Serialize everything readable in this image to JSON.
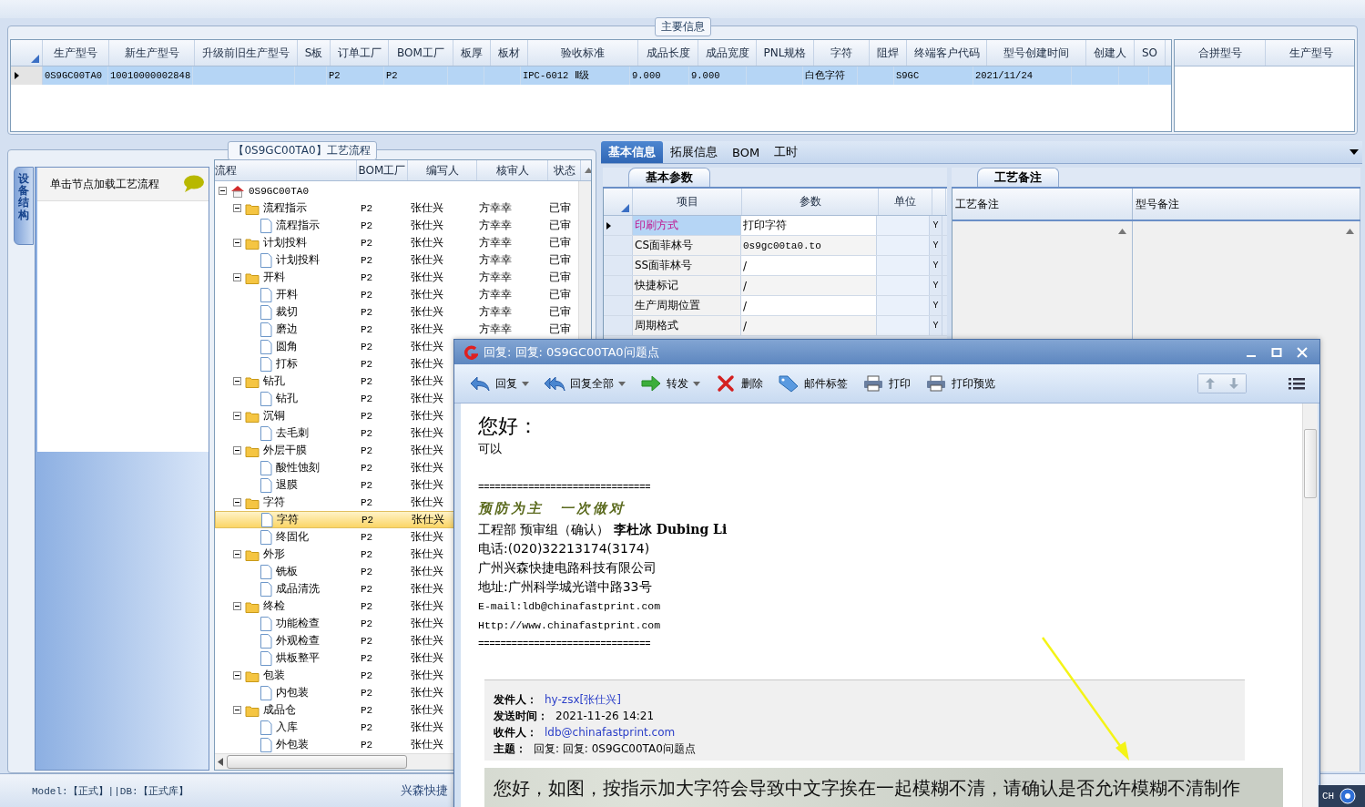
{
  "main_info": {
    "title": "主要信息",
    "columns": [
      "生产型号",
      "新生产型号",
      "升级前旧生产型号",
      "S板",
      "订单工厂",
      "BOM工厂",
      "板厚",
      "板材",
      "验收标准",
      "成品长度",
      "成品宽度",
      "PNL规格",
      "字符",
      "阻焊",
      "终端客户代码",
      "型号创建时间",
      "创建人",
      "SO"
    ],
    "rows": [
      {
        "selected": true,
        "cells": [
          "0S9GC00TA0",
          "10010000002848",
          null,
          null,
          "P2",
          "P2",
          null,
          null,
          "IPC-6012 Ⅱ级",
          "9.000",
          "9.000",
          null,
          "白色字符",
          null,
          "S9GC",
          "2021/11/24",
          null,
          null
        ]
      }
    ],
    "merge_columns": [
      "合拼型号",
      "生产型号"
    ]
  },
  "process_panel": {
    "title": "【0S9GC00TA0】工艺流程",
    "side_tab": "设备结构",
    "hint": "单击节点加载工艺流程",
    "columns": [
      "流程",
      "BOM工厂",
      "编写人",
      "核审人",
      "状态"
    ],
    "tree": [
      {
        "label": "0S9GC00TA0",
        "kind": "root",
        "expanded": true,
        "selected": false,
        "children": [
          {
            "label": "流程指示",
            "kind": "folder",
            "expanded": true,
            "selected": false,
            "bom": "P2",
            "writer": "张仕兴",
            "reviewer": "方幸幸",
            "status": "已审",
            "children": [
              {
                "label": "流程指示",
                "kind": "doc",
                "selected": false,
                "bom": "P2",
                "writer": "张仕兴",
                "reviewer": "方幸幸",
                "status": "已审"
              }
            ]
          },
          {
            "label": "计划投料",
            "kind": "folder",
            "expanded": true,
            "selected": false,
            "bom": "P2",
            "writer": "张仕兴",
            "reviewer": "方幸幸",
            "status": "已审",
            "children": [
              {
                "label": "计划投料",
                "kind": "doc",
                "selected": false,
                "bom": "P2",
                "writer": "张仕兴",
                "reviewer": "方幸幸",
                "status": "已审"
              }
            ]
          },
          {
            "label": "开料",
            "kind": "folder",
            "expanded": true,
            "selected": false,
            "bom": "P2",
            "writer": "张仕兴",
            "reviewer": "方幸幸",
            "status": "已审",
            "children": [
              {
                "label": "开料",
                "kind": "doc",
                "selected": false,
                "bom": "P2",
                "writer": "张仕兴",
                "reviewer": "方幸幸",
                "status": "已审"
              },
              {
                "label": "裁切",
                "kind": "doc",
                "selected": false,
                "bom": "P2",
                "writer": "张仕兴",
                "reviewer": "方幸幸",
                "status": "已审"
              },
              {
                "label": "磨边",
                "kind": "doc",
                "selected": false,
                "bom": "P2",
                "writer": "张仕兴",
                "reviewer": "方幸幸",
                "status": "已审"
              },
              {
                "label": "圆角",
                "kind": "doc",
                "selected": false,
                "bom": "P2",
                "writer": "张仕兴"
              },
              {
                "label": "打标",
                "kind": "doc",
                "selected": false,
                "bom": "P2",
                "writer": "张仕兴"
              }
            ]
          },
          {
            "label": "钻孔",
            "kind": "folder",
            "expanded": true,
            "selected": false,
            "bom": "P2",
            "writer": "张仕兴",
            "children": [
              {
                "label": "钻孔",
                "kind": "doc",
                "selected": false,
                "bom": "P2",
                "writer": "张仕兴"
              }
            ]
          },
          {
            "label": "沉铜",
            "kind": "folder",
            "expanded": true,
            "selected": false,
            "bom": "P2",
            "writer": "张仕兴",
            "children": [
              {
                "label": "去毛刺",
                "kind": "doc",
                "selected": false,
                "bom": "P2",
                "writer": "张仕兴"
              }
            ]
          },
          {
            "label": "外层干膜",
            "kind": "folder",
            "expanded": true,
            "selected": false,
            "bom": "P2",
            "writer": "张仕兴",
            "children": [
              {
                "label": "酸性蚀刻",
                "kind": "doc",
                "selected": false,
                "bom": "P2",
                "writer": "张仕兴"
              },
              {
                "label": "退膜",
                "kind": "doc",
                "selected": false,
                "bom": "P2",
                "writer": "张仕兴"
              }
            ]
          },
          {
            "label": "字符",
            "kind": "folder",
            "expanded": true,
            "selected": false,
            "bom": "P2",
            "writer": "张仕兴",
            "children": [
              {
                "label": "字符",
                "kind": "doc",
                "selected": true,
                "bom": "P2",
                "writer": "张仕兴"
              },
              {
                "label": "终固化",
                "kind": "doc",
                "selected": false,
                "bom": "P2",
                "writer": "张仕兴"
              }
            ]
          },
          {
            "label": "外形",
            "kind": "folder",
            "expanded": true,
            "selected": false,
            "bom": "P2",
            "writer": "张仕兴",
            "children": [
              {
                "label": "铣板",
                "kind": "doc",
                "selected": false,
                "bom": "P2",
                "writer": "张仕兴"
              },
              {
                "label": "成品清洗",
                "kind": "doc",
                "selected": false,
                "bom": "P2",
                "writer": "张仕兴"
              }
            ]
          },
          {
            "label": "终检",
            "kind": "folder",
            "expanded": true,
            "selected": false,
            "bom": "P2",
            "writer": "张仕兴",
            "children": [
              {
                "label": "功能检查",
                "kind": "doc",
                "selected": false,
                "bom": "P2",
                "writer": "张仕兴"
              },
              {
                "label": "外观检查",
                "kind": "doc",
                "selected": false,
                "bom": "P2",
                "writer": "张仕兴"
              },
              {
                "label": "烘板整平",
                "kind": "doc",
                "selected": false,
                "bom": "P2",
                "writer": "张仕兴"
              }
            ]
          },
          {
            "label": "包装",
            "kind": "folder",
            "expanded": true,
            "selected": false,
            "bom": "P2",
            "writer": "张仕兴",
            "children": [
              {
                "label": "内包装",
                "kind": "doc",
                "selected": false,
                "bom": "P2",
                "writer": "张仕兴"
              }
            ]
          },
          {
            "label": "成品仓",
            "kind": "folder",
            "expanded": true,
            "selected": false,
            "bom": "P2",
            "writer": "张仕兴",
            "children": [
              {
                "label": "入库",
                "kind": "doc",
                "selected": false,
                "bom": "P2",
                "writer": "张仕兴"
              },
              {
                "label": "外包装",
                "kind": "doc",
                "selected": false,
                "bom": "P2",
                "writer": "张仕兴"
              }
            ]
          }
        ]
      }
    ]
  },
  "detail_panel": {
    "tabs": [
      {
        "label": "基本信息",
        "selected": true
      },
      {
        "label": "拓展信息",
        "selected": false
      },
      {
        "label": "BOM",
        "selected": false
      },
      {
        "label": "工时",
        "selected": false
      }
    ],
    "basic_params": {
      "tab": "基本参数",
      "columns": [
        "项目",
        "参数",
        "单位"
      ],
      "rows": [
        {
          "item": "印刷方式",
          "value": "打印字符",
          "column_4": "Y",
          "selected": true
        },
        {
          "item": "CS面菲林号",
          "value": "0s9gc00ta0.to",
          "column_4": "Y",
          "selected": false
        },
        {
          "item": "SS面菲林号",
          "value": "/",
          "column_4": "Y",
          "selected": false
        },
        {
          "item": "快捷标记",
          "value": "/",
          "column_4": "Y",
          "selected": false
        },
        {
          "item": "生产周期位置",
          "value": "/",
          "column_4": "Y",
          "selected": false
        },
        {
          "item": "周期格式",
          "value": "/",
          "column_4": "Y",
          "selected": false
        }
      ]
    },
    "notes": {
      "tab": "工艺备注",
      "columns": [
        "工艺备注",
        "型号备注"
      ]
    }
  },
  "status_bar": {
    "left": "Model:【正式】||DB:【正式库】",
    "right": "兴森快捷"
  },
  "tray": {
    "language": "CH"
  },
  "email_window": {
    "title": "回复: 回复: 0S9GC00TA0问题点",
    "toolbar": [
      {
        "label": "回复",
        "kind": "reply",
        "dropdown": true
      },
      {
        "label": "回复全部",
        "kind": "reply_all",
        "dropdown": true
      },
      {
        "label": "转发",
        "kind": "forward",
        "dropdown": true
      },
      {
        "label": "删除",
        "kind": "delete",
        "dropdown": false
      },
      {
        "label": "邮件标签",
        "kind": "tag",
        "dropdown": false
      },
      {
        "label": "打印",
        "kind": "print",
        "dropdown": false
      },
      {
        "label": "打印预览",
        "kind": "print",
        "dropdown": false
      }
    ],
    "body": {
      "greeting": "您好：",
      "text": "可以",
      "separator": "===============================",
      "motto": "预防为主　一次做对",
      "signature": [
        {
          "text": "工程部 预审组（确认） **李杜冰 Dubing Li**",
          "kind": "plain"
        },
        {
          "text": "电话:(020)32213174(3174)",
          "kind": "plain"
        },
        {
          "text": "广州兴森快捷电路科技有限公司",
          "kind": "plain"
        },
        {
          "text": "地址:广州科学城光谱中路33号",
          "kind": "plain"
        },
        {
          "text": "E-mail:ldb@chinafastprint.com",
          "kind": "mono"
        },
        {
          "text": "Http://www.chinafastprint.com",
          "kind": "mono"
        }
      ],
      "separator_end": "===============================",
      "quote_header": [
        {
          "label": "发件人：",
          "value": "hy-zsx[张仕兴]",
          "kind": "link"
        },
        {
          "label": "发送时间：",
          "value": "2021-11-26 14:21",
          "kind": "text"
        },
        {
          "label": "收件人：",
          "value": "ldb@chinafastprint.com",
          "kind": "link"
        },
        {
          "label": "主题：",
          "value": "回复: 回复: 0S9GC00TA0问题点",
          "kind": "text"
        }
      ],
      "quoted_image_text": "您好，如图，按指示加大字符会导致中文字挨在一起模糊不清，请确认是否允许模糊不清制作"
    }
  }
}
